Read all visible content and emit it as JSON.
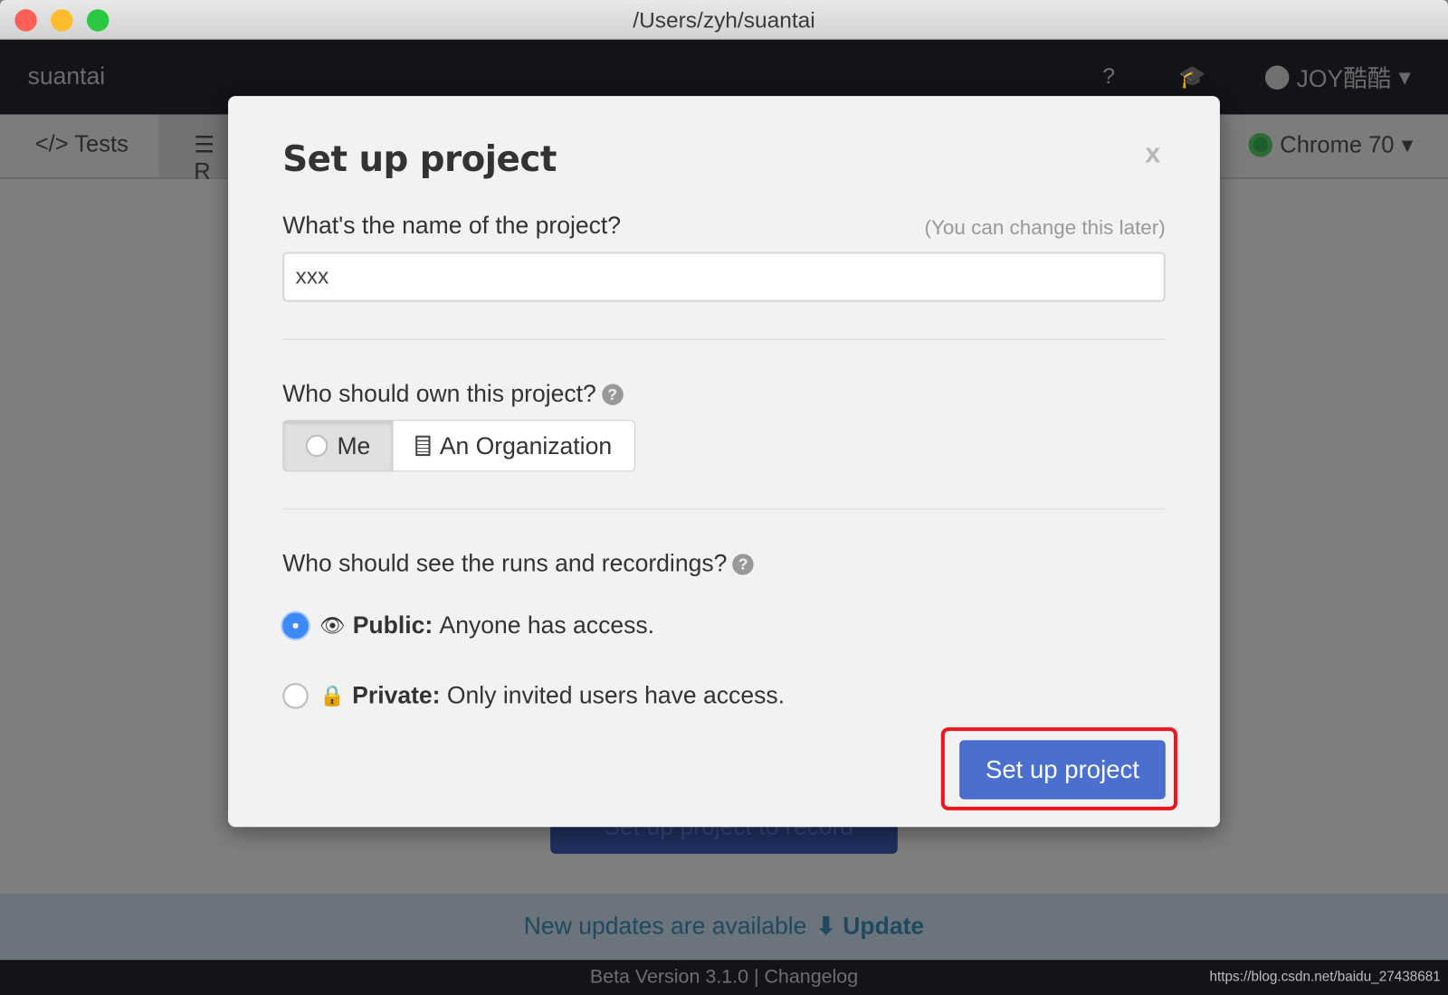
{
  "window": {
    "title": "/Users/zyh/suantai"
  },
  "appbar": {
    "brand": "suantai",
    "user": "JOY酷酷"
  },
  "tabs": [
    {
      "label": "Tests",
      "icon": "code-icon"
    },
    {
      "label": "R",
      "icon": "database-icon"
    }
  ],
  "browser": {
    "label": "Chrome 70"
  },
  "background": {
    "button": "Set up project to record"
  },
  "update_bar": {
    "text": "New updates are available",
    "link": "Update"
  },
  "footer": {
    "version": "Beta Version 3.1.0",
    "changelog": "Changelog",
    "url": "https://blog.csdn.net/baidu_27438681"
  },
  "modal": {
    "title": "Set up project",
    "close": "x",
    "name_label": "What's the name of the project?",
    "name_hint": "(You can change this later)",
    "name_value": "xxx",
    "owner_label": "Who should own this project?",
    "owner_options": [
      "Me",
      "An Organization"
    ],
    "owner_selected": "Me",
    "visibility_label": "Who should see the runs and recordings?",
    "public_title": "Public:",
    "public_desc": "Anyone has access.",
    "private_title": "Private:",
    "private_desc": "Only invited users have access.",
    "visibility_selected": "Public",
    "submit": "Set up project"
  },
  "colors": {
    "primary": "#4a6fcf",
    "radio": "#3d8af7",
    "highlight": "#f0141e"
  }
}
